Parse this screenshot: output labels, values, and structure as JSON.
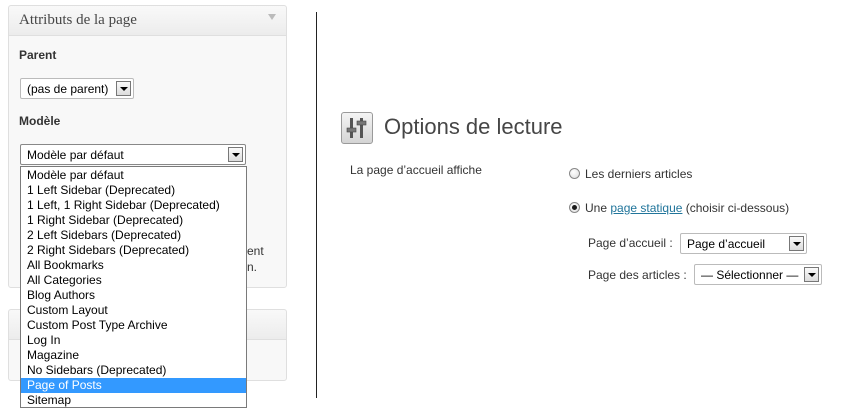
{
  "metabox": {
    "title": "Attributs de la page",
    "parent_label": "Parent",
    "parent_value": "(pas de parent)",
    "template_label": "Modèle",
    "template_value": "Modèle par défaut",
    "partial_1": "ent",
    "partial_2": "n."
  },
  "template_dropdown": {
    "options": [
      "Modèle par défaut",
      "1 Left Sidebar (Deprecated)",
      "1 Left, 1 Right Sidebar (Deprecated)",
      "1 Right Sidebar (Deprecated)",
      "2 Left Sidebars (Deprecated)",
      "2 Right Sidebars (Deprecated)",
      "All Bookmarks",
      "All Categories",
      "Blog Authors",
      "Custom Layout",
      "Custom Post Type Archive",
      "Log In",
      "Magazine",
      "No Sidebars (Deprecated)",
      "Page of Posts",
      "Sitemap"
    ],
    "highlighted": "Page of Posts"
  },
  "reading": {
    "title": "Options de lecture",
    "icon": "settings-sliders-icon",
    "front_page_label": "La page d’accueil affiche",
    "option_latest": "Les derniers articles",
    "option_static_prefix": "Une",
    "option_static_link": "page statique",
    "option_static_suffix": "(choisir ci-dessous)",
    "homepage_label": "Page d’accueil :",
    "homepage_value": "Page d’accueil",
    "posts_page_label": "Page des articles :",
    "posts_page_value": "— Sélectionner —",
    "selected_option": "static"
  },
  "colors": {
    "highlight": "#3399ff",
    "link": "#21759b"
  }
}
